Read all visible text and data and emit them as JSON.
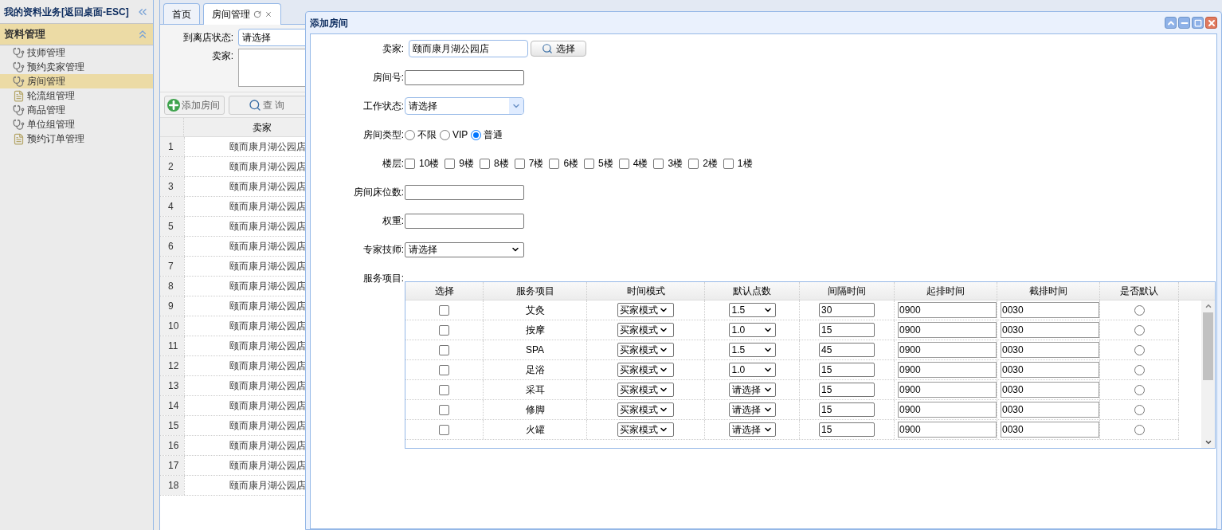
{
  "sidebar": {
    "title": "我的资料业务[返回桌面-ESC]",
    "section": {
      "title": "资料管理",
      "expanded": true
    },
    "items": [
      {
        "label": "技师管理",
        "kind": "module",
        "selected": false
      },
      {
        "label": "预约卖家管理",
        "kind": "module",
        "selected": false
      },
      {
        "label": "房间管理",
        "kind": "module",
        "selected": true
      },
      {
        "label": "轮流组管理",
        "kind": "page",
        "selected": false
      },
      {
        "label": "商品管理",
        "kind": "module",
        "selected": false
      },
      {
        "label": "单位组管理",
        "kind": "module",
        "selected": false
      },
      {
        "label": "预约订单管理",
        "kind": "page",
        "selected": false
      }
    ]
  },
  "tabs": [
    {
      "label": "首页",
      "selected": false,
      "closable": false
    },
    {
      "label": "房间管理",
      "selected": true,
      "closable": true
    }
  ],
  "filter": {
    "status_label": "到离店状态:",
    "status_value": "请选择",
    "seller_label": "卖家:"
  },
  "toolbar": [
    {
      "label": "添加房间",
      "kind": "add"
    },
    {
      "label": "查 询",
      "kind": "search"
    }
  ],
  "grid": {
    "columns": [
      "卖家"
    ],
    "rows": [
      {
        "index": "1",
        "seller": "颐而康月湖公园店"
      },
      {
        "index": "2",
        "seller": "颐而康月湖公园店"
      },
      {
        "index": "3",
        "seller": "颐而康月湖公园店"
      },
      {
        "index": "4",
        "seller": "颐而康月湖公园店"
      },
      {
        "index": "5",
        "seller": "颐而康月湖公园店"
      },
      {
        "index": "6",
        "seller": "颐而康月湖公园店"
      },
      {
        "index": "7",
        "seller": "颐而康月湖公园店"
      },
      {
        "index": "8",
        "seller": "颐而康月湖公园店"
      },
      {
        "index": "9",
        "seller": "颐而康月湖公园店"
      },
      {
        "index": "10",
        "seller": "颐而康月湖公园店"
      },
      {
        "index": "11",
        "seller": "颐而康月湖公园店"
      },
      {
        "index": "12",
        "seller": "颐而康月湖公园店"
      },
      {
        "index": "13",
        "seller": "颐而康月湖公园店"
      },
      {
        "index": "14",
        "seller": "颐而康月湖公园店"
      },
      {
        "index": "15",
        "seller": "颐而康月湖公园店"
      },
      {
        "index": "16",
        "seller": "颐而康月湖公园店"
      },
      {
        "index": "17",
        "seller": "颐而康月湖公园店"
      },
      {
        "index": "18",
        "seller": "颐而康月湖公园店"
      }
    ]
  },
  "dialog": {
    "title": "添加房间",
    "fields": [
      {
        "kind": "lookup",
        "label": "卖家:",
        "value": "颐而康月湖公园店",
        "button": "选择"
      },
      {
        "kind": "text",
        "label": "房间号:"
      },
      {
        "kind": "combo",
        "label": "工作状态:",
        "value": "请选择"
      },
      {
        "kind": "radio",
        "label": "房间类型:",
        "options": [
          {
            "label": "不限",
            "selected": false
          },
          {
            "label": "VIP",
            "selected": false
          },
          {
            "label": "普通",
            "selected": true
          }
        ]
      },
      {
        "kind": "checks",
        "label": "楼层:",
        "options": [
          {
            "label": "10楼",
            "checked": false
          },
          {
            "label": "9楼",
            "checked": false
          },
          {
            "label": "8楼",
            "checked": false
          },
          {
            "label": "7楼",
            "checked": false
          },
          {
            "label": "6楼",
            "checked": false
          },
          {
            "label": "5楼",
            "checked": false
          },
          {
            "label": "4楼",
            "checked": false
          },
          {
            "label": "3楼",
            "checked": false
          },
          {
            "label": "2楼",
            "checked": false
          },
          {
            "label": "1楼",
            "checked": false
          }
        ]
      },
      {
        "kind": "text",
        "label": "房间床位数:"
      },
      {
        "kind": "text",
        "label": "权重:"
      },
      {
        "kind": "select",
        "label": "专家技师:",
        "value": "请选择"
      },
      {
        "kind": "label",
        "label": "服务项目:"
      }
    ],
    "services": {
      "columns": [
        "选择",
        "服务项目",
        "时间模式",
        "默认点数",
        "间隔时间",
        "起排时间",
        "截排时间",
        "是否默认"
      ],
      "rows": [
        {
          "checked": false,
          "name": "艾灸",
          "mode": "买家模式",
          "points": "1.5",
          "interval": "30",
          "start": "0900",
          "end": "0030",
          "default": false
        },
        {
          "checked": false,
          "name": "按摩",
          "mode": "买家模式",
          "points": "1.0",
          "interval": "15",
          "start": "0900",
          "end": "0030",
          "default": false
        },
        {
          "checked": false,
          "name": "SPA",
          "mode": "买家模式",
          "points": "1.5",
          "interval": "45",
          "start": "0900",
          "end": "0030",
          "default": false
        },
        {
          "checked": false,
          "name": "足浴",
          "mode": "买家模式",
          "points": "1.0",
          "interval": "15",
          "start": "0900",
          "end": "0030",
          "default": false
        },
        {
          "checked": false,
          "name": "采耳",
          "mode": "买家模式",
          "points": "请选择",
          "interval": "15",
          "start": "0900",
          "end": "0030",
          "default": false
        },
        {
          "checked": false,
          "name": "修脚",
          "mode": "买家模式",
          "points": "请选择",
          "interval": "15",
          "start": "0900",
          "end": "0030",
          "default": false
        },
        {
          "checked": false,
          "name": "火罐",
          "mode": "买家模式",
          "points": "请选择",
          "interval": "15",
          "start": "0900",
          "end": "0030",
          "default": false
        }
      ]
    }
  }
}
